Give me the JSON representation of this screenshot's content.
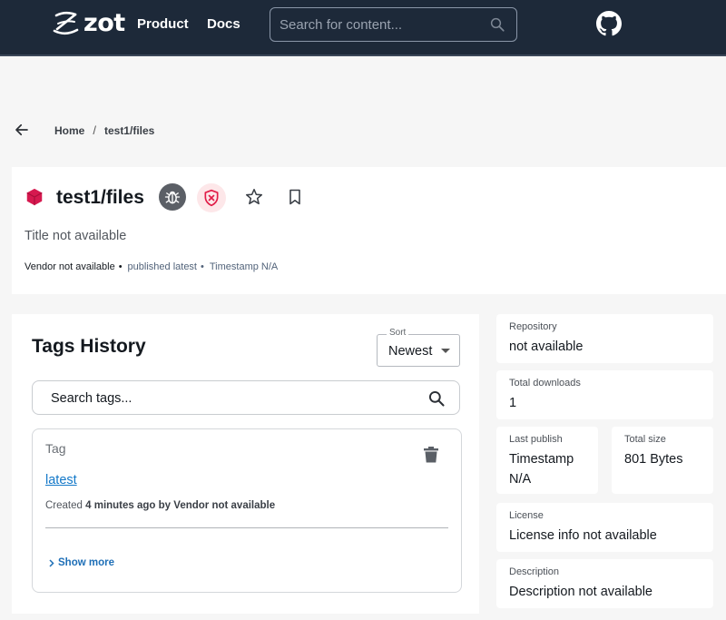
{
  "topbar": {
    "logo_text": "zot",
    "nav": {
      "product": "Product",
      "docs": "Docs"
    },
    "search_placeholder": "Search for content..."
  },
  "breadcrumb": {
    "home": "Home",
    "separator": "/",
    "current": "test1/files"
  },
  "repo": {
    "name": "test1/files",
    "title": "Title not available",
    "vendor": "Vendor not available",
    "published": "published latest",
    "timestamp": "Timestamp N/A",
    "bullet": "•"
  },
  "tags_history": {
    "title": "Tags History",
    "sort_label": "Sort",
    "sort_value": "Newest",
    "search_placeholder": "Search tags...",
    "items": [
      {
        "label": "Tag",
        "name": "latest",
        "created_prefix": "Created",
        "created_time": "4 minutes ago",
        "created_by": "by",
        "vendor": "Vendor not available",
        "show_more": "Show more"
      }
    ]
  },
  "sidebar": {
    "repository": {
      "label": "Repository",
      "value": "not available"
    },
    "downloads": {
      "label": "Total downloads",
      "value": "1"
    },
    "last_publish": {
      "label": "Last publish",
      "value": "Timestamp N/A"
    },
    "size": {
      "label": "Total size",
      "value": "801 Bytes"
    },
    "license": {
      "label": "License",
      "value": "License info not available"
    },
    "description": {
      "label": "Description",
      "value": "Description not available"
    }
  },
  "colors": {
    "topbar": "#1d2939",
    "accent_link": "#1479c9",
    "cube": "#d6194f",
    "shield_alert": "#e11d48"
  }
}
